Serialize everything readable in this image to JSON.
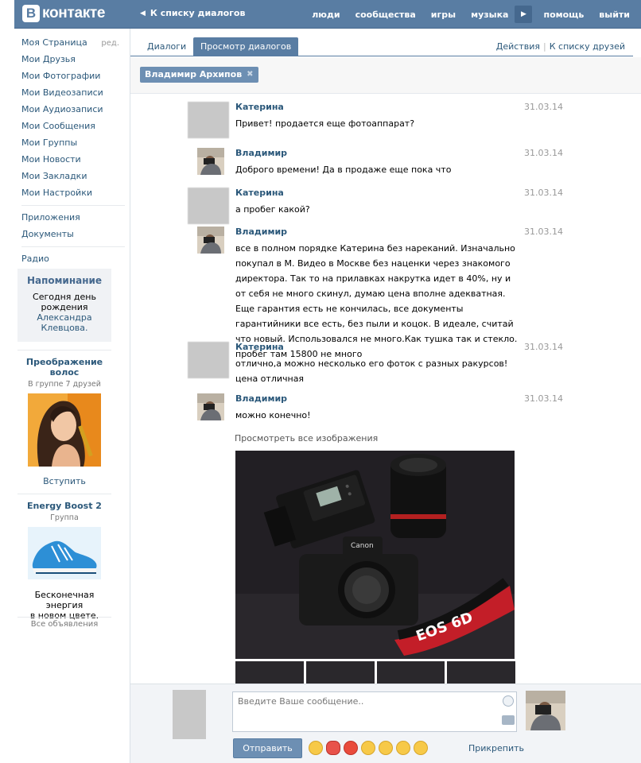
{
  "header": {
    "logo_letter": "В",
    "logo_text": "контакте",
    "back_link": "К списку диалогов",
    "nav": [
      "люди",
      "сообщества",
      "игры",
      "музыка",
      "помощь",
      "выйти"
    ]
  },
  "sidebar": {
    "menu": [
      "Моя Страница",
      "Мои Друзья",
      "Мои Фотографии",
      "Мои Видеозаписи",
      "Мои Аудиозаписи",
      "Мои Сообщения",
      "Мои Группы",
      "Мои Новости",
      "Мои Закладки",
      "Мои Настройки"
    ],
    "edit_label": "ред.",
    "menu2": [
      "Приложения",
      "Документы"
    ],
    "menu3": [
      "Радио"
    ],
    "reminder": {
      "title": "Напоминание",
      "line1": "Сегодня день",
      "line2": "рождения",
      "name1": "Александра",
      "name2": "Клевцова."
    },
    "ads": [
      {
        "title_1": "Преображение",
        "title_2": "волос",
        "sub": "В группе 7 друзей",
        "link": "Вступить"
      },
      {
        "title_1": "Energy Boost 2",
        "sub": "Группа",
        "text_1": "Бесконечная энергия",
        "text_2": "в новом цвете."
      }
    ],
    "all_ads": "Все объявления"
  },
  "tabs": {
    "dialogs": "Диалоги",
    "view": "Просмотр диалогов",
    "actions": "Действия",
    "to_friends": "К списку друзей"
  },
  "filter": {
    "chip": "Владимир Архипов"
  },
  "messages": [
    {
      "author": "Катерина",
      "date": "31.03.14",
      "text": "Привет! продается еще фотоаппарат?"
    },
    {
      "author": "Владимир",
      "date": "31.03.14",
      "text": "Доброго времени! Да в продаже еще пока что"
    },
    {
      "author": "Катерина",
      "date": "31.03.14",
      "text": "а пробег какой?"
    },
    {
      "author": "Владимир",
      "date": "31.03.14",
      "text": "все в полном порядке Катерина без нареканий. Изначально покупал в М. Видео в Москве без наценки через знакомого директора. Так то на прилавках накрутка идет в 40%, ну и от себя не много скинул, думаю цена вполне адекватная. Еще гарантия есть не кончилась, все документы гарантийники все есть, без пыли и коцок. В идеале, считай что новый. Использовался не много.Как тушка так и стекло. пробег там 15800 не много"
    },
    {
      "author": "Катерина",
      "date": "31.03.14",
      "text": "отлично,а можно несколько его фоток с разных ракурсов! цена отличная"
    },
    {
      "author": "Владимир",
      "date": "31.03.14",
      "text": "можно конечно!"
    }
  ],
  "photos": {
    "view_all": "Просмотреть все изображения",
    "camera_brand": "Canon",
    "strap_text": "EOS 6D"
  },
  "composer": {
    "placeholder": "Введите Ваше сообщение..",
    "send": "Отправить",
    "attach": "Прикрепить"
  },
  "colors": {
    "brand": "#597da3",
    "link": "#2b587a"
  }
}
